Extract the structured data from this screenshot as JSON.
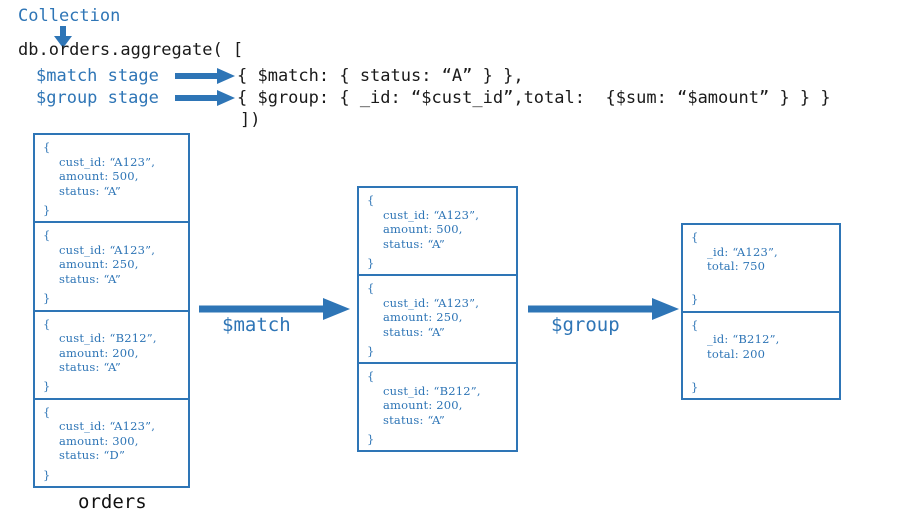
{
  "annotation": {
    "collection_label": "Collection",
    "match_stage_label": "$match stage",
    "group_stage_label": "$group stage"
  },
  "code": {
    "line1": "db.orders.aggregate( [",
    "line2": "{ $match: { status: “A” } },",
    "line3": "{ $group: { _id: “$cust_id”,total:  {$sum: “$amount” } } }",
    "line4": "])"
  },
  "flow": {
    "match_arrow_label": "$match",
    "group_arrow_label": "$group"
  },
  "collection_name": "orders",
  "columns": {
    "source": {
      "name": "orders-collection",
      "docs": [
        {
          "open": "{",
          "lines": [
            "cust_id: “A123”,",
            "amount: 500,",
            "status: “A”"
          ],
          "close": "}"
        },
        {
          "open": "{",
          "lines": [
            "cust_id: “A123”,",
            "amount: 250,",
            "status: “A”"
          ],
          "close": "}"
        },
        {
          "open": "{",
          "lines": [
            "cust_id: “B212”,",
            "amount: 200,",
            "status: “A”"
          ],
          "close": "}"
        },
        {
          "open": "{",
          "lines": [
            "cust_id: “A123”,",
            "amount: 300,",
            "status: “D”"
          ],
          "close": "}"
        }
      ]
    },
    "matched": {
      "name": "match-result",
      "docs": [
        {
          "open": "{",
          "lines": [
            "cust_id: “A123”,",
            "amount: 500,",
            "status: “A”"
          ],
          "close": "}"
        },
        {
          "open": "{",
          "lines": [
            "cust_id: “A123”,",
            "amount: 250,",
            "status: “A”"
          ],
          "close": "}"
        },
        {
          "open": "{",
          "lines": [
            "cust_id: “B212”,",
            "amount: 200,",
            "status: “A”"
          ],
          "close": "}"
        }
      ]
    },
    "grouped": {
      "name": "group-result",
      "docs": [
        {
          "open": "{",
          "lines": [
            "_id: “A123”,",
            "total: 750"
          ],
          "close": "}"
        },
        {
          "open": "{",
          "lines": [
            "_id: “B212”,",
            "total: 200"
          ],
          "close": "}"
        }
      ]
    }
  },
  "colors": {
    "accent": "#2e75b6",
    "text": "#1a1a1a"
  }
}
